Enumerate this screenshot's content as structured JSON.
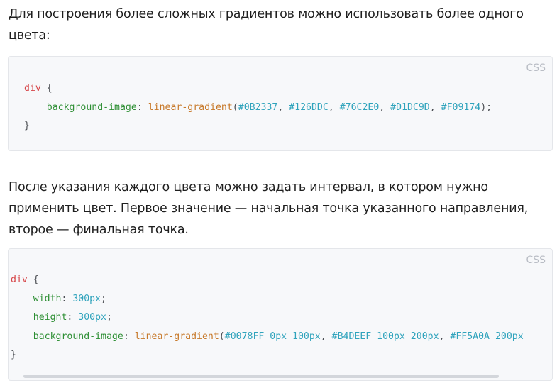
{
  "intro_text": "Для построения более сложных градиентов можно использовать более одного цвета:",
  "code1": {
    "lang": "CSS",
    "selector": "div",
    "open_brace": " {",
    "property": "background-image",
    "function": "linear-gradient",
    "colors": [
      "#0B2337",
      "#126DDC",
      "#76C2E0",
      "#D1DC9D",
      "#F09174"
    ],
    "close_brace": "}"
  },
  "interval_text": "После указания каждого цвета можно задать интервал, в котором нужно применить цвет. Первое значение — начальная точка указанного направления, второе — финальная точка.",
  "code2": {
    "lang": "CSS",
    "selector": "div",
    "open_brace": " {",
    "width_prop": "width",
    "width_val": "300px",
    "height_prop": "height",
    "height_val": "300px",
    "bg_prop": "background-image",
    "function": "linear-gradient",
    "stop1_color": "#0078FF",
    "stop1_range": "0px 100px",
    "stop2_color": "#B4DEEF",
    "stop2_range": "100px 200px",
    "stop3_color": "#FF5A0A",
    "stop3_range": "200px",
    "close_brace": "}"
  }
}
